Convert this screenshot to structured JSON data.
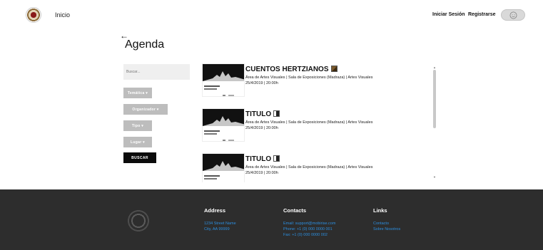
{
  "header": {
    "home_label": "Inicio",
    "login_label": "Iniciar Sesión",
    "register_label": "Registrarse",
    "user_icon": "smiley-user-icon"
  },
  "page": {
    "back_icon": "arrow-left-icon",
    "title": "Agenda"
  },
  "filters": {
    "search_placeholder": "Buscar...",
    "tematica": "Temática ▾",
    "organizador": "Organizador ▾",
    "tipo": "Tipo ▾",
    "lugar": "Lugar ▾",
    "search_button": "BUSCAR"
  },
  "events": [
    {
      "title": "CUENTOS HERTZIANOS",
      "place": "Área de Artes Visuales | Sala de Exposiciones (Madraza) | Artes Visuales",
      "date": "25/4/2019 | 20:00h"
    },
    {
      "title": "TITULO",
      "place": "Área de Artes Visuales | Sala de Exposiciones (Madraza) | Artes Visuales",
      "date": "25/4/2019 | 20:00h"
    },
    {
      "title": "TITULO",
      "place": "Área de Artes Visuales | Sala de Exposiciones (Madraza) | Artes Visuales",
      "date": "25/4/2019 | 20:00h"
    }
  ],
  "footer": {
    "address": {
      "title": "Address",
      "lines": [
        "1234 Street Name",
        "City, AA 99999"
      ]
    },
    "contacts": {
      "title": "Contacts",
      "lines": [
        "Email: support@mobirise.com",
        "Phone: +1 (0) 000 0000 001",
        "Fax: +1 (0) 000 0000 002"
      ]
    },
    "links": {
      "title": "Links",
      "lines": [
        "Contacto",
        "Sobre Nosotros"
      ]
    }
  },
  "colors": {
    "footer_bg": "#2d2d2d",
    "link_blue": "#2c8fe0",
    "filter_gray": "#bdbdbd",
    "button_black": "#0b0b0b"
  }
}
